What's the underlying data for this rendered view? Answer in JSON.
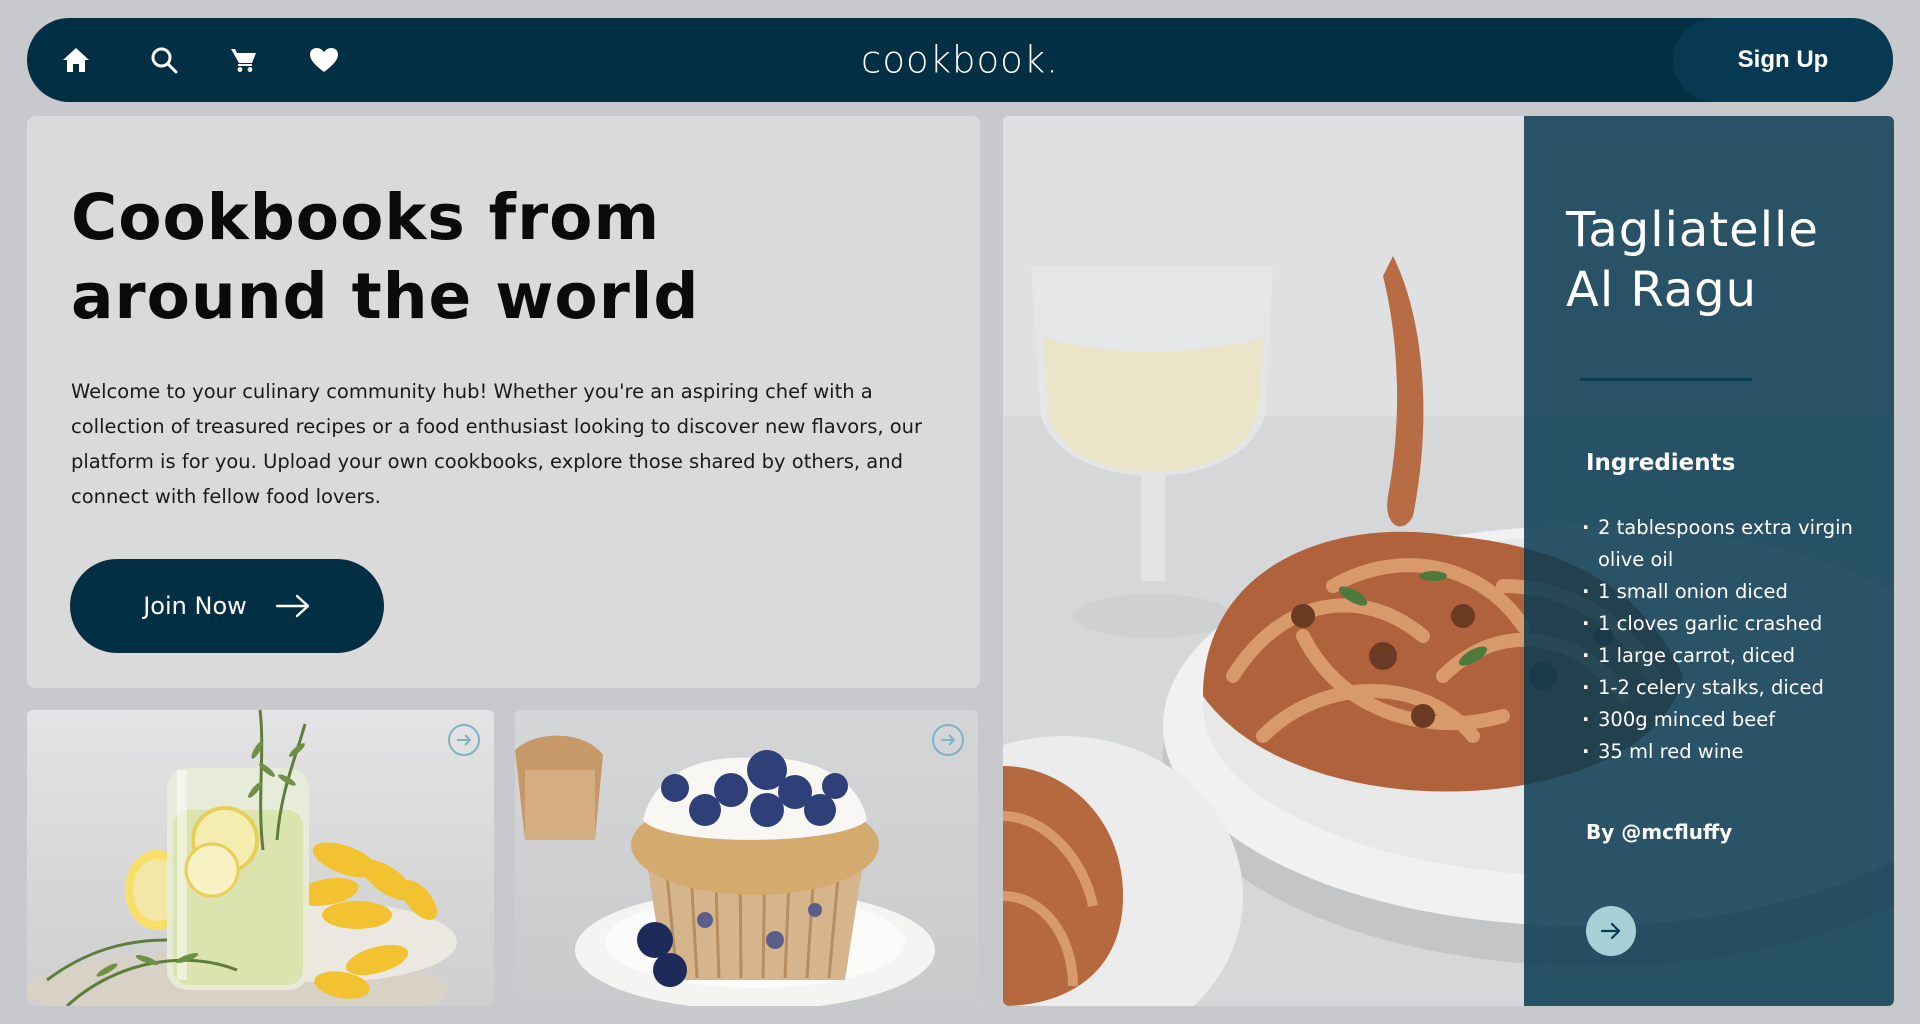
{
  "navbar": {
    "icons": [
      "home-icon",
      "search-icon",
      "cart-icon",
      "heart-icon"
    ],
    "brand": "cookbook.",
    "signup_label": "Sign Up"
  },
  "hero": {
    "title_line1": "Cookbooks from",
    "title_line2": "around the world",
    "description": "Welcome to your culinary community hub! Whether you're an aspiring chef with a collection of treasured recipes or a food enthusiast looking to discover new flavors, our platform is for you. Upload your own cookbooks, explore those shared by others, and connect with fellow food lovers.",
    "cta_label": "Join Now",
    "cta_icon": "arrow-right-icon"
  },
  "cards": [
    {
      "image": "lemonade-glass-with-rosemary",
      "action_icon": "arrow-circle-icon"
    },
    {
      "image": "blueberry-muffin",
      "action_icon": "arrow-circle-icon"
    }
  ],
  "featured_recipe": {
    "image": "tagliatelle-pasta-plate",
    "title_line1": "Tagliatelle",
    "title_line2": "Al Ragu",
    "ingredients_heading": "Ingredients",
    "ingredients": [
      "2 tablespoons extra virgin olive oil",
      "1 small onion diced",
      "1 cloves garlic crashed",
      "1 large carrot, diced",
      "1-2 celery stalks, diced",
      "300g minced beef",
      "35 ml red wine"
    ],
    "author": "By @mcfluffy",
    "action_icon": "arrow-right-icon"
  },
  "colors": {
    "navy": "#032f44",
    "page_bg": "#c8c9cc",
    "hero_bg": "#dadada",
    "panel_overlay": "#0b3a52",
    "accent_teal": "#a6d0d6"
  }
}
